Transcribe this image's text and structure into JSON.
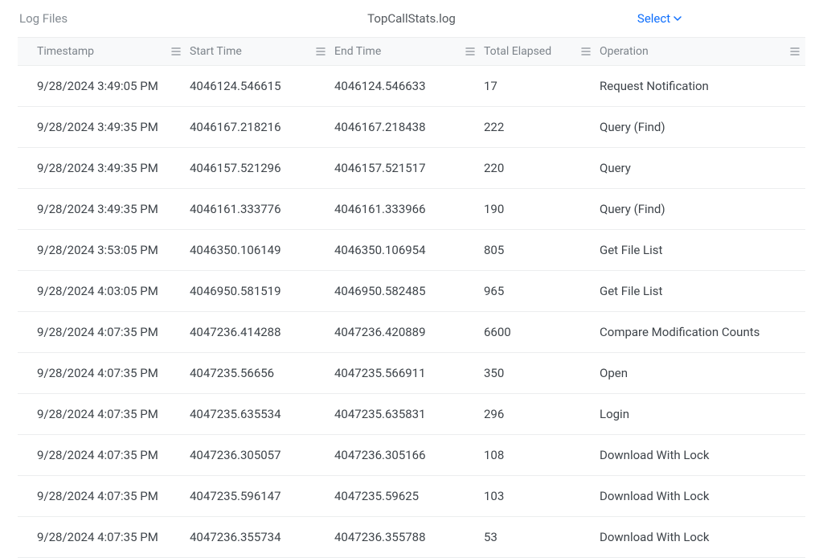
{
  "header": {
    "breadcrumb": "Log Files",
    "title": "TopCallStats.log",
    "select_label": "Select"
  },
  "table": {
    "columns": {
      "timestamp": "Timestamp",
      "start": "Start Time",
      "end": "End Time",
      "elapsed": "Total Elapsed",
      "operation": "Operation"
    },
    "rows": [
      {
        "timestamp": "9/28/2024 3:49:05 PM",
        "start": "4046124.546615",
        "end": "4046124.546633",
        "elapsed": "17",
        "operation": "Request Notification"
      },
      {
        "timestamp": "9/28/2024 3:49:35 PM",
        "start": "4046167.218216",
        "end": "4046167.218438",
        "elapsed": "222",
        "operation": "Query (Find)"
      },
      {
        "timestamp": "9/28/2024 3:49:35 PM",
        "start": "4046157.521296",
        "end": "4046157.521517",
        "elapsed": "220",
        "operation": "Query"
      },
      {
        "timestamp": "9/28/2024 3:49:35 PM",
        "start": "4046161.333776",
        "end": "4046161.333966",
        "elapsed": "190",
        "operation": "Query (Find)"
      },
      {
        "timestamp": "9/28/2024 3:53:05 PM",
        "start": "4046350.106149",
        "end": "4046350.106954",
        "elapsed": "805",
        "operation": "Get File List"
      },
      {
        "timestamp": "9/28/2024 4:03:05 PM",
        "start": "4046950.581519",
        "end": "4046950.582485",
        "elapsed": "965",
        "operation": "Get File List"
      },
      {
        "timestamp": "9/28/2024 4:07:35 PM",
        "start": "4047236.414288",
        "end": "4047236.420889",
        "elapsed": "6600",
        "operation": "Compare Modification Counts"
      },
      {
        "timestamp": "9/28/2024 4:07:35 PM",
        "start": "4047235.56656",
        "end": "4047235.566911",
        "elapsed": "350",
        "operation": "Open"
      },
      {
        "timestamp": "9/28/2024 4:07:35 PM",
        "start": "4047235.635534",
        "end": "4047235.635831",
        "elapsed": "296",
        "operation": "Login"
      },
      {
        "timestamp": "9/28/2024 4:07:35 PM",
        "start": "4047236.305057",
        "end": "4047236.305166",
        "elapsed": "108",
        "operation": "Download With Lock"
      },
      {
        "timestamp": "9/28/2024 4:07:35 PM",
        "start": "4047235.596147",
        "end": "4047235.59625",
        "elapsed": "103",
        "operation": "Download With Lock"
      },
      {
        "timestamp": "9/28/2024 4:07:35 PM",
        "start": "4047236.355734",
        "end": "4047236.355788",
        "elapsed": "53",
        "operation": "Download With Lock"
      }
    ]
  }
}
